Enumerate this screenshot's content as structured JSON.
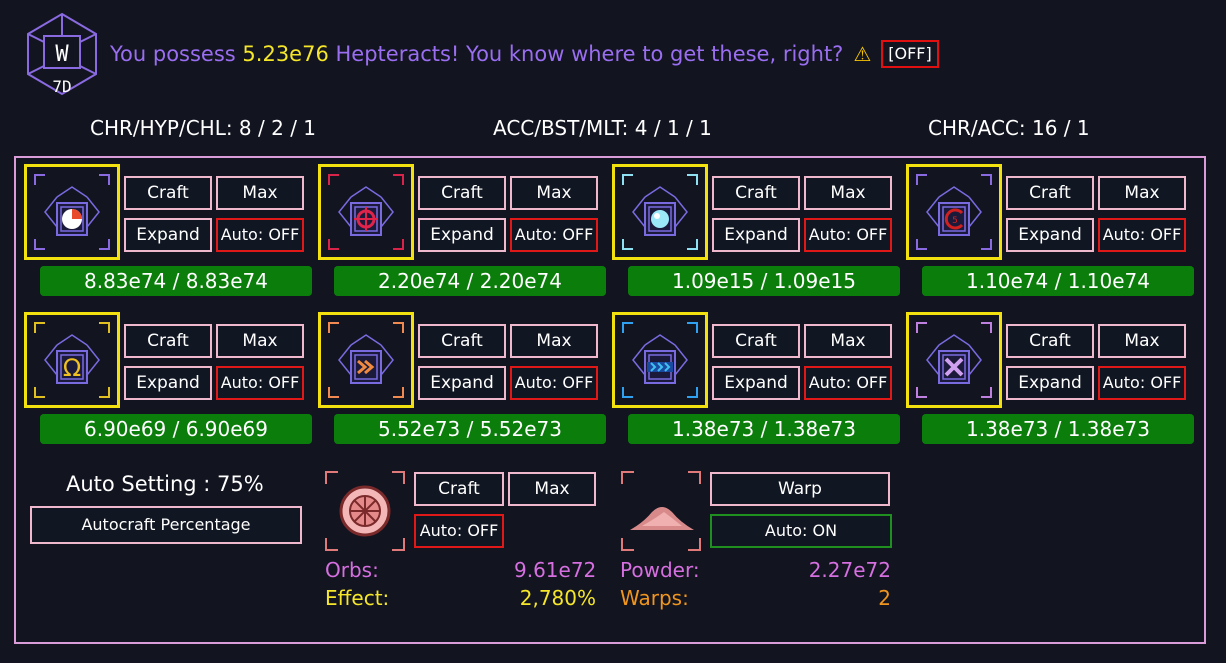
{
  "header": {
    "intro_text": "You possess",
    "amount": "5.23e76",
    "suffix_text": "Hepteracts! You know where to get these, right?",
    "warning_icon": "warning-icon",
    "toggle_label": "[OFF]"
  },
  "stats": {
    "chr_hyp_chl": "CHR/HYP/CHL: 8 / 2 / 1",
    "acc_bst_mlt": "ACC/BST/MLT: 4 / 1 / 1",
    "chr_acc": "CHR/ACC: 16 / 1"
  },
  "labels": {
    "craft": "Craft",
    "max": "Max",
    "expand": "Expand"
  },
  "hepteracts": [
    {
      "name": "chronos",
      "icon": "pie-clock-icon",
      "accent": "#8a6ae0",
      "auto": "Auto: OFF",
      "value": "8.83e74 / 8.83e74",
      "fill": 1.0
    },
    {
      "name": "hyperrealism",
      "icon": "crosshair-icon",
      "accent": "#d8234a",
      "auto": "Auto: OFF",
      "value": "2.20e74 / 2.20e74",
      "fill": 1.0
    },
    {
      "name": "quark",
      "icon": "orb-icon",
      "accent": "#8fe0f0",
      "auto": "Auto: OFF",
      "value": "1.09e15 / 1.09e15",
      "fill": 1.0
    },
    {
      "name": "challenge",
      "icon": "challenge-c-icon",
      "accent": "#8a6ae0",
      "auto": "Auto: OFF",
      "value": "1.10e74 / 1.10e74",
      "fill": 1.0
    },
    {
      "name": "abyss",
      "icon": "omega-icon",
      "accent": "#e0c020",
      "auto": "Auto: OFF",
      "value": "6.90e69 / 6.90e69",
      "fill": 1.0
    },
    {
      "name": "accelerator",
      "icon": "double-chevron-orange-icon",
      "accent": "#f08a50",
      "auto": "Auto: OFF",
      "value": "5.52e73 / 5.52e73",
      "fill": 1.0
    },
    {
      "name": "booster",
      "icon": "triple-chevron-blue-icon",
      "accent": "#30a0f0",
      "auto": "Auto: OFF",
      "value": "1.38e73 / 1.38e73",
      "fill": 1.0
    },
    {
      "name": "multiplier",
      "icon": "x-multiply-icon",
      "accent": "#c080e0",
      "auto": "Auto: OFF",
      "value": "1.38e73 / 1.38e73",
      "fill": 1.0
    }
  ],
  "auto_setting": {
    "label": "Auto Setting : 75%",
    "button": "Autocraft Percentage"
  },
  "orbs": {
    "icon": "orb-fan-icon",
    "auto": "Auto: OFF",
    "orbs_label": "Orbs:",
    "orbs_value": "9.61e72",
    "effect_label": "Effect:",
    "effect_value": "2,780%"
  },
  "powder": {
    "icon": "powder-pile-icon",
    "warp": "Warp",
    "auto": "Auto: ON",
    "powder_label": "Powder:",
    "powder_value": "2.27e72",
    "warps_label": "Warps:",
    "warps_value": "2"
  },
  "colors": {
    "background": "#121420",
    "accent_yellow": "#f5e62a",
    "text_purple": "#9a6ef0",
    "bar_green": "#0b7d0b",
    "off_red": "#e01010",
    "on_green": "#1f8f1f",
    "button_border": "#f0b8cc"
  }
}
